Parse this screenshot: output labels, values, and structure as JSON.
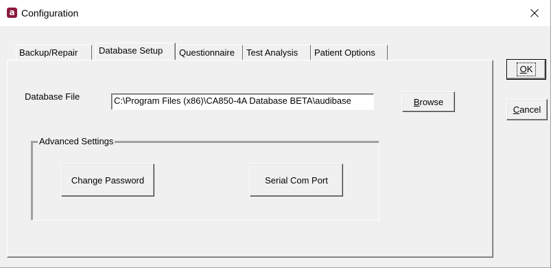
{
  "window": {
    "title": "Configuration",
    "icon_letter": "a",
    "close_glyph": "×"
  },
  "tabs": [
    {
      "label": "Backup/Repair",
      "active": false
    },
    {
      "label": "Database Setup",
      "active": true
    },
    {
      "label": "Questionnaire",
      "active": false
    },
    {
      "label": "Test Analysis",
      "active": false
    },
    {
      "label": "Patient Options",
      "active": false
    }
  ],
  "database": {
    "file_label": "Database File",
    "file_value": "C:\\Program Files (x86)\\CA850-4A Database BETA\\audibase",
    "browse_label_mnemonic": "B",
    "browse_label_rest": "rowse"
  },
  "advanced": {
    "group_title": "Advanced Settings",
    "change_password_label": "Change Password",
    "serial_com_port_label": "Serial Com Port"
  },
  "dialog_buttons": {
    "ok_mnemonic": "O",
    "ok_rest": "K",
    "cancel_mnemonic": "C",
    "cancel_rest": "ancel"
  },
  "colors": {
    "icon_bg": "#8b1a3e",
    "dialog_bg": "#f0f0f0",
    "titlebar_bg": "#ffffff"
  },
  "icons": {
    "app_icon": "app-logo-icon",
    "close_icon": "close-icon"
  }
}
